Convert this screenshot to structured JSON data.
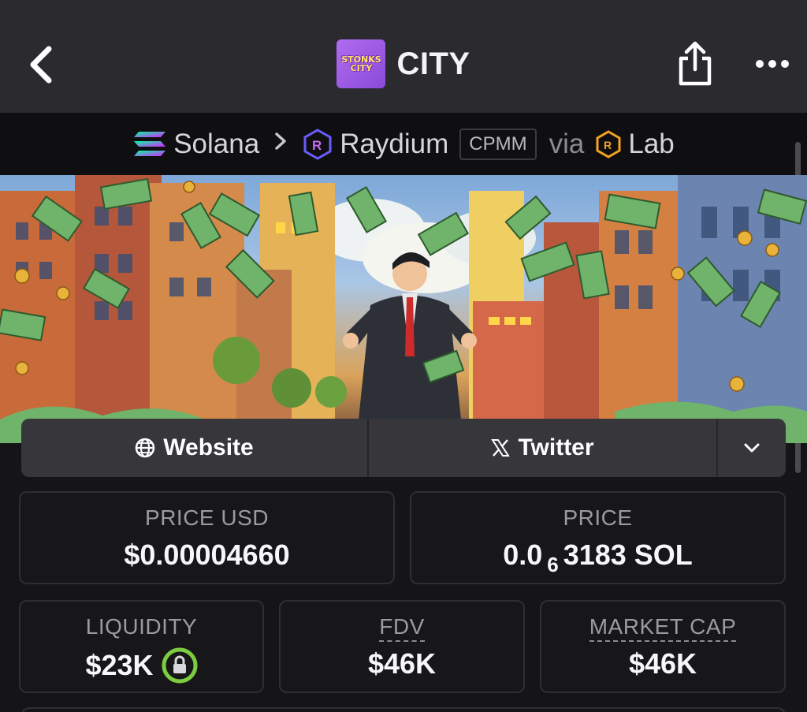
{
  "header": {
    "title": "CITY",
    "logo_text_line1": "STONKS",
    "logo_text_line2": "CITY"
  },
  "breadcrumb": {
    "chain": "Solana",
    "dex": "Raydium",
    "pool_type": "CPMM",
    "via_label": "via",
    "launchpad": "Lab"
  },
  "links": {
    "website_label": "Website",
    "twitter_label": "Twitter"
  },
  "stats": {
    "price_usd_label": "PRICE USD",
    "price_usd_value": "$0.00004660",
    "price_label": "PRICE",
    "price_prefix": "0.0",
    "price_zero_count": "6",
    "price_suffix": "3183 SOL",
    "liquidity_label": "LIQUIDITY",
    "liquidity_value": "$23K",
    "fdv_label": "FDV",
    "fdv_value": "$46K",
    "market_cap_label": "MARKET CAP",
    "market_cap_value": "$46K"
  },
  "colors": {
    "background": "#151518",
    "header_bg": "#2b2b2f",
    "lock_green": "#7ccc3f",
    "solana_gradient": [
      "#00ffa3",
      "#dc1fff"
    ],
    "raydium_purple": "#6a5cff",
    "lab_orange": "#f3a223"
  },
  "icons": [
    "chevron-left-icon",
    "share-icon",
    "more-icon",
    "solana-icon",
    "raydium-icon",
    "lab-icon",
    "globe-icon",
    "x-icon",
    "chevron-down-icon",
    "lock-icon"
  ]
}
